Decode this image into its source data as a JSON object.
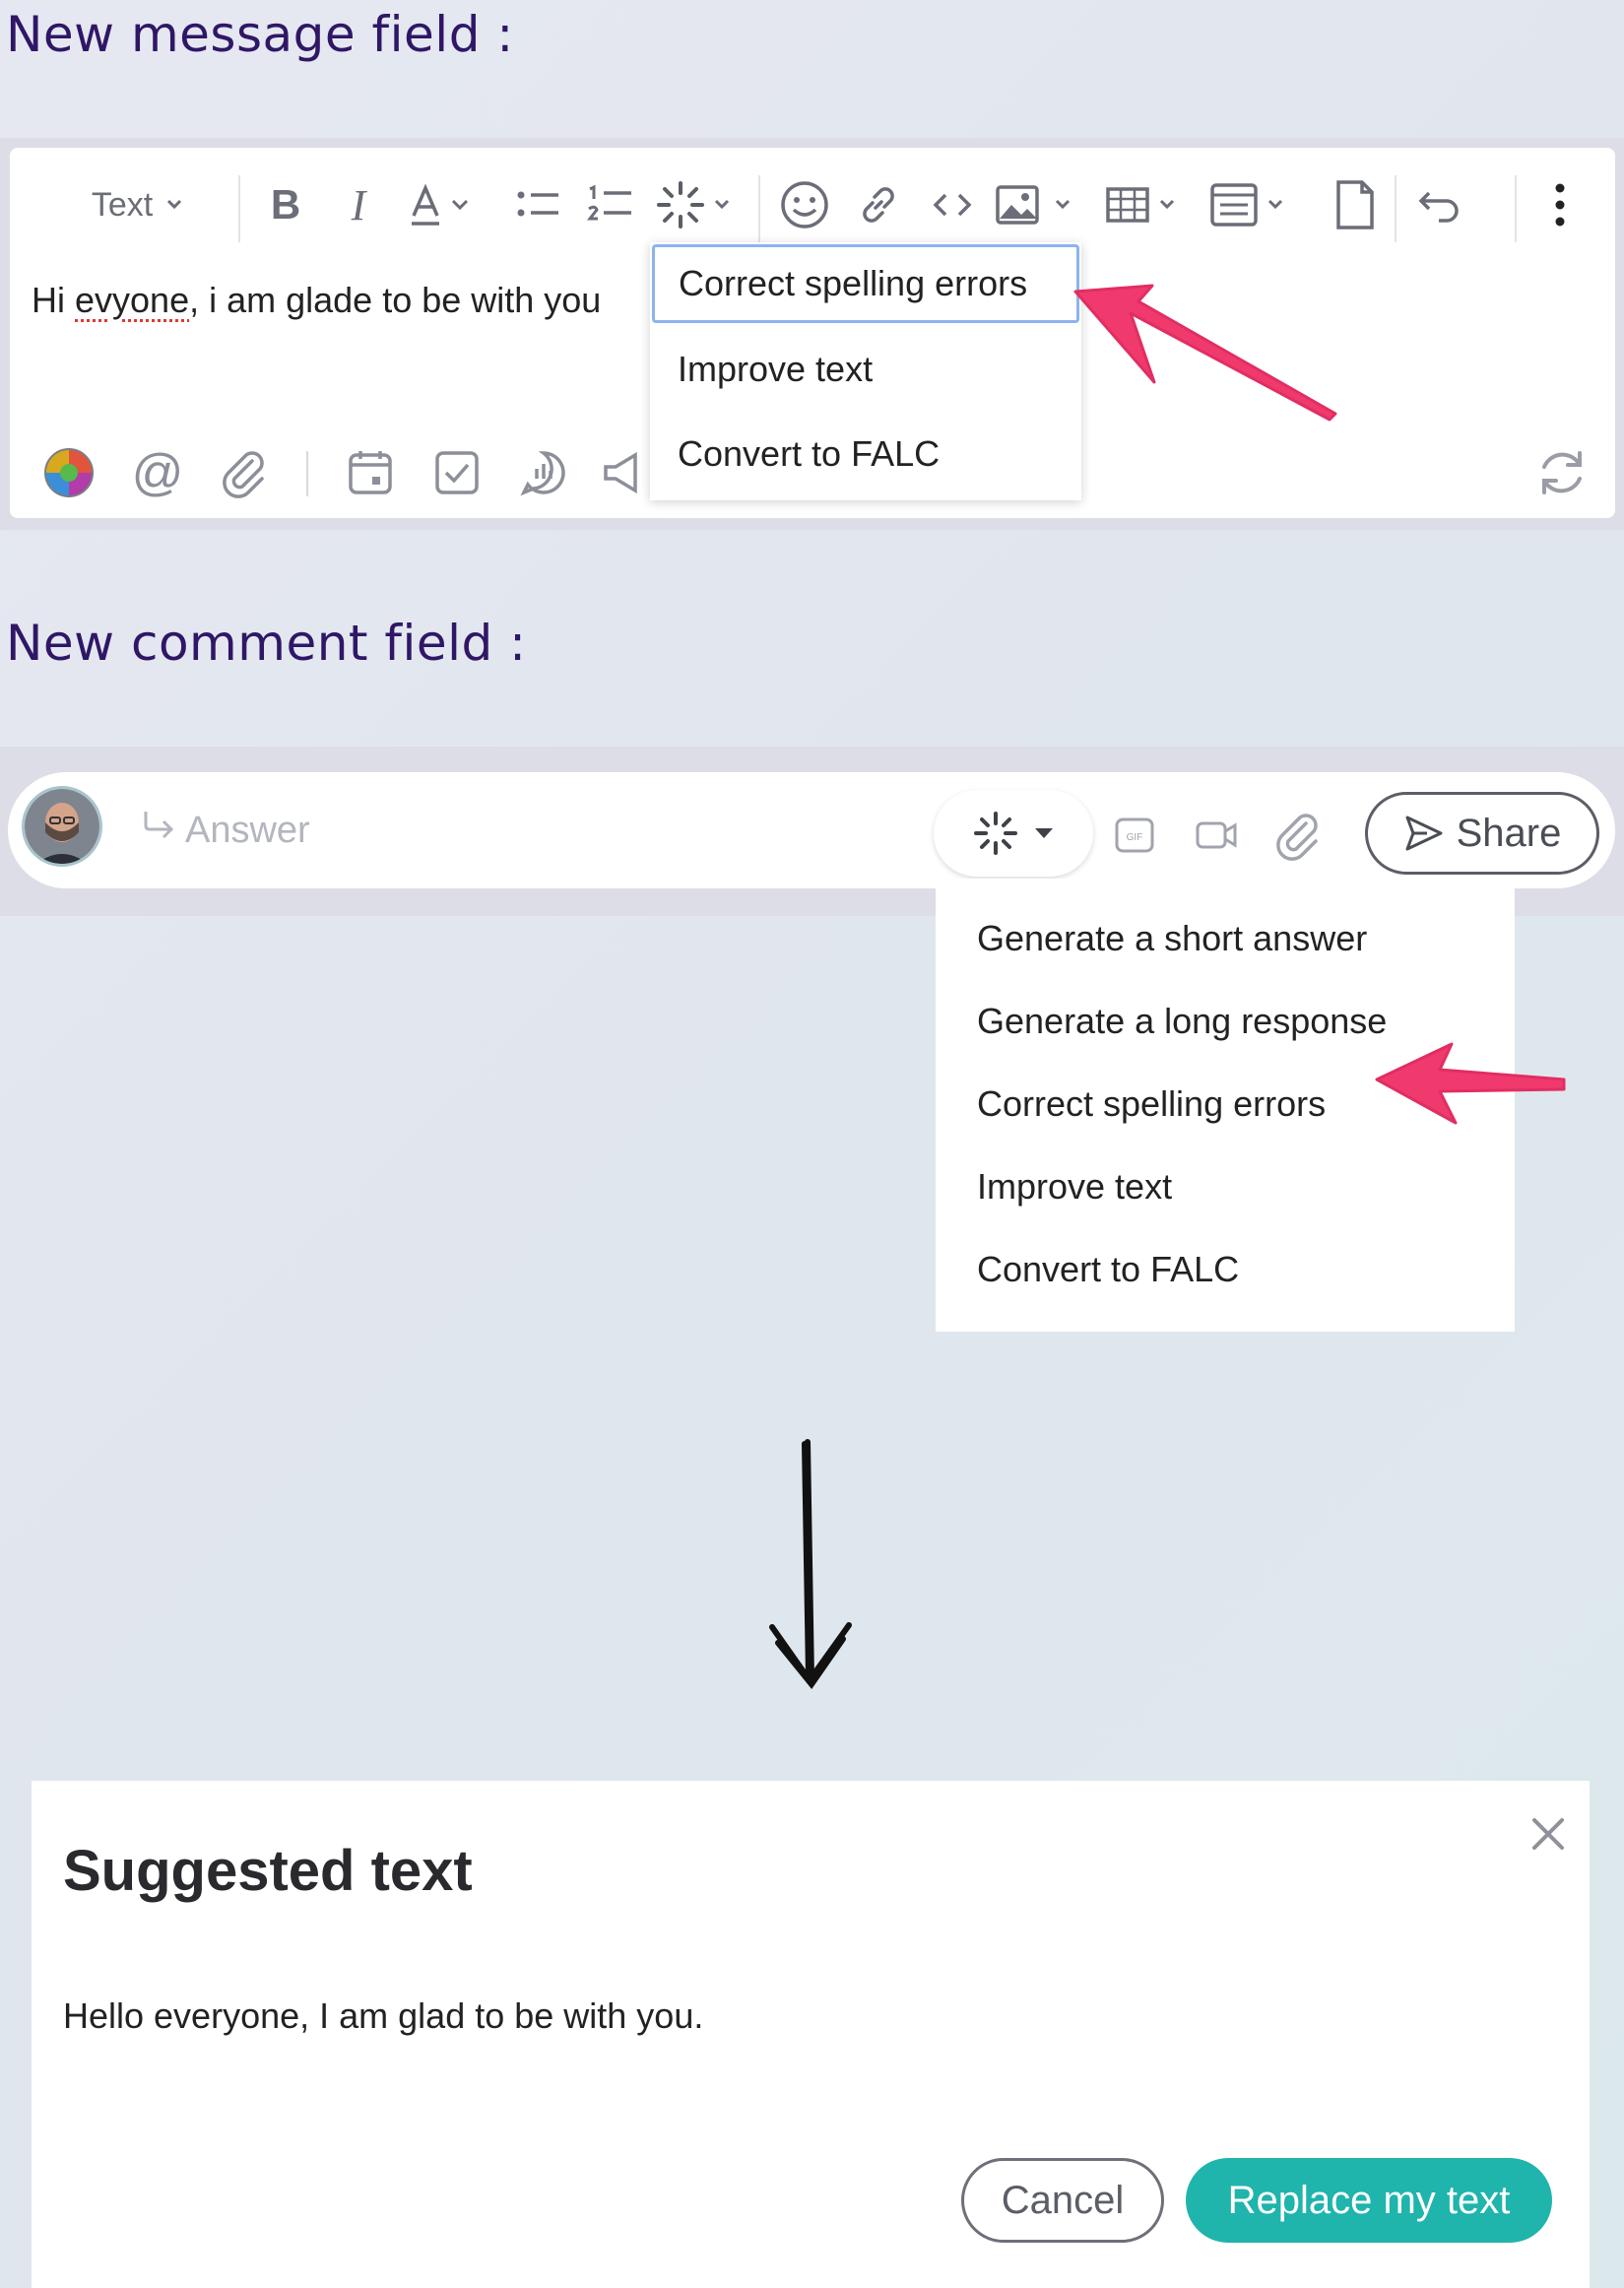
{
  "headings": {
    "message_field": "New message field :",
    "comment_field": "New comment field :"
  },
  "message_editor": {
    "text_style": "Text",
    "content_prefix": "Hi ",
    "content_misspelled": "evyone",
    "content_suffix": ", i am glade to be with you",
    "ai_menu": {
      "items": [
        "Correct spelling errors",
        "Improve text",
        "Convert to FALC"
      ],
      "selected": "Correct spelling errors"
    },
    "toolbar_icons": [
      "bold-icon",
      "italic-icon",
      "font-color-icon",
      "bullet-list-icon",
      "numbered-list-icon",
      "ai-sparkle-icon",
      "emoji-icon",
      "link-icon",
      "code-icon",
      "image-icon",
      "table-icon",
      "template-icon",
      "document-icon",
      "undo-icon",
      "more-icon"
    ],
    "bottom_icons": [
      "color-palette-icon",
      "mention-icon",
      "attachment-icon",
      "calendar-icon",
      "task-checkbox-icon",
      "poll-icon",
      "announcement-icon",
      "refresh-icon"
    ]
  },
  "comment_field": {
    "placeholder": "Answer",
    "share_label": "Share",
    "ai_menu": {
      "items": [
        "Generate a short answer",
        "Generate a long response",
        "Correct spelling errors",
        "Improve text",
        "Convert to FALC"
      ]
    },
    "icons": [
      "reply-icon",
      "ai-sparkle-icon",
      "gif-icon",
      "video-icon",
      "attachment-icon",
      "send-icon"
    ]
  },
  "dialog": {
    "title": "Suggested text",
    "body": "Hello everyone, I am glad to be with you.",
    "cancel_label": "Cancel",
    "replace_label": "Replace my text"
  },
  "colors": {
    "heading": "#2f1766",
    "accent_teal": "#1fb4ac",
    "annotation_pink": "#f03a6e",
    "selection_border": "#8db3ee"
  }
}
